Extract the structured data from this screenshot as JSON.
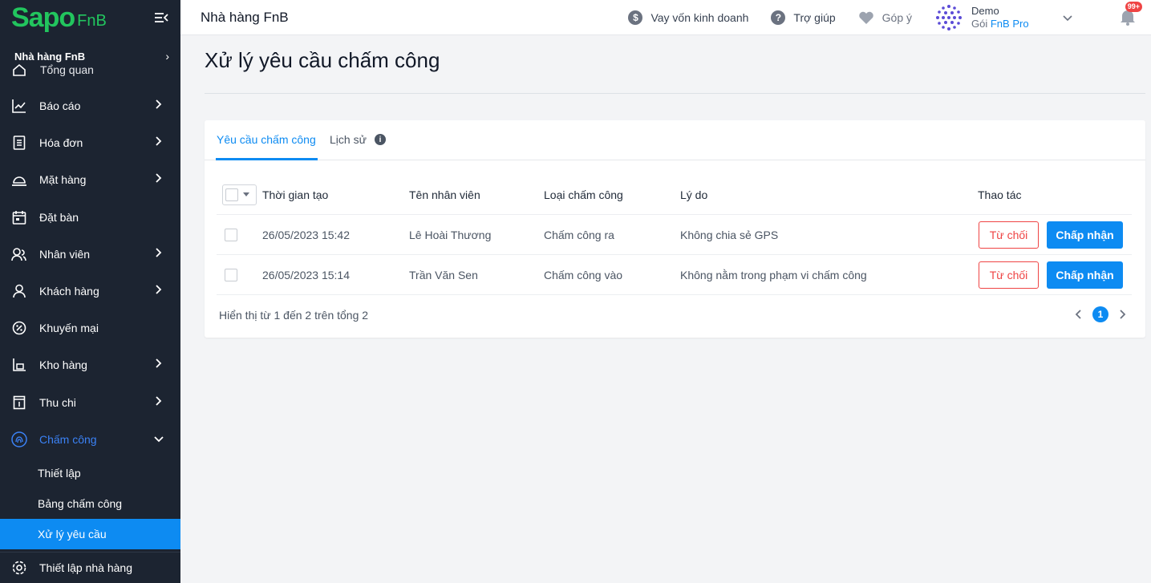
{
  "sidebar": {
    "logo": {
      "brand": "Sapo",
      "suffix": "FnB"
    },
    "store_name": "Nhà hàng FnB",
    "overlap_item": "Tổng quan",
    "items": [
      {
        "label": "Báo cáo",
        "icon": "chart-line-icon",
        "has_children": true
      },
      {
        "label": "Hóa đơn",
        "icon": "invoice-icon",
        "has_children": true
      },
      {
        "label": "Mặt hàng",
        "icon": "cloche-icon",
        "has_children": true
      },
      {
        "label": "Đặt bàn",
        "icon": "calendar-icon",
        "has_children": false
      },
      {
        "label": "Nhân viên",
        "icon": "staff-icon",
        "has_children": true
      },
      {
        "label": "Khách hàng",
        "icon": "customer-icon",
        "has_children": true
      },
      {
        "label": "Khuyến mại",
        "icon": "promotion-icon",
        "has_children": false
      },
      {
        "label": "Kho hàng",
        "icon": "warehouse-icon",
        "has_children": true
      },
      {
        "label": "Thu chi",
        "icon": "cash-icon",
        "has_children": true
      },
      {
        "label": "Chấm công",
        "icon": "fingerprint-icon",
        "has_children": true,
        "active": true
      }
    ],
    "sub_items": [
      "Thiết lập",
      "Bảng chấm công",
      "Xử lý yêu cầu"
    ],
    "bottom_item": "Thiết lập nhà hàng"
  },
  "topbar": {
    "title": "Nhà hàng FnB",
    "loan": "Vay vốn kinh doanh",
    "help": "Trợ giúp",
    "feedback": "Góp ý",
    "account_name": "Demo",
    "plan_prefix": "Gói",
    "plan_name": "FnB Pro",
    "notification_badge": "99+"
  },
  "page": {
    "title": "Xử lý yêu cầu chấm công",
    "tabs": [
      "Yêu cầu chấm công",
      "Lịch sử"
    ],
    "columns": [
      "Thời gian tạo",
      "Tên nhân viên",
      "Loại chấm công",
      "Lý do",
      "Thao tác"
    ],
    "rows": [
      {
        "time": "26/05/2023 15:42",
        "name": "Lê Hoài Thương",
        "type": "Chấm công ra",
        "reason": "Không chia sẻ GPS"
      },
      {
        "time": "26/05/2023 15:14",
        "name": "Trần Văn Sen",
        "type": "Chấm công vào",
        "reason": "Không nằm trong phạm vi chấm công"
      }
    ],
    "reject_label": "Từ chối",
    "accept_label": "Chấp nhận",
    "summary": "Hiển thị từ 1 đến 2 trên tổng 2",
    "current_page": "1"
  },
  "colors": {
    "accent": "#0d8bf2",
    "sidebar_bg": "#1c2431",
    "danger": "#ef4444",
    "brand_green": "#22c55e"
  }
}
